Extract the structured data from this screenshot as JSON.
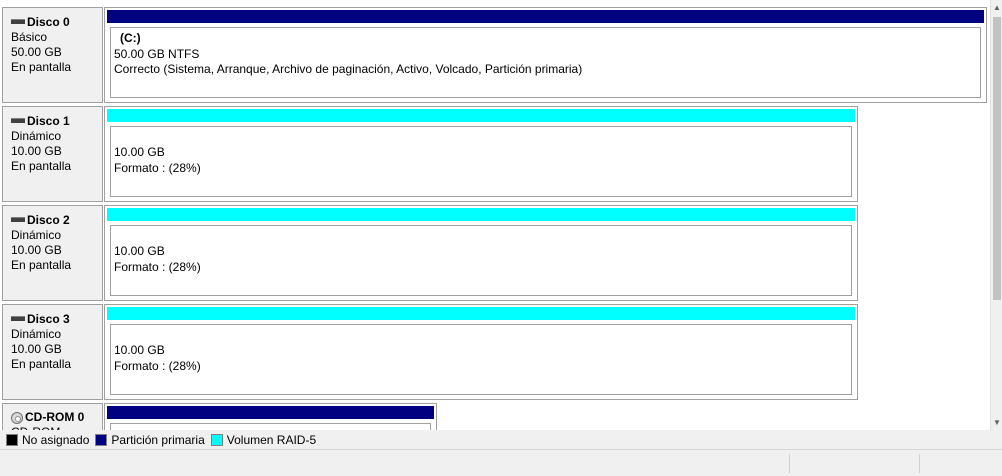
{
  "disks": [
    {
      "name": "Disco 0",
      "type": "Básico",
      "size": "50.00 GB",
      "status": "En pantalla",
      "volume": {
        "title": "(C:)",
        "line1": "50.00 GB NTFS",
        "line2": "Correcto (Sistema, Arranque, Archivo de paginación, Activo, Volcado, Partición primaria)",
        "bar_color": "#000080"
      }
    },
    {
      "name": "Disco 1",
      "type": "Dinámico",
      "size": "10.00 GB",
      "status": "En pantalla",
      "volume": {
        "title": "",
        "line1": "10.00 GB",
        "line2": "Formato : (28%)",
        "bar_color": "#00ffff"
      }
    },
    {
      "name": "Disco 2",
      "type": "Dinámico",
      "size": "10.00 GB",
      "status": "En pantalla",
      "volume": {
        "title": "",
        "line1": "10.00 GB",
        "line2": "Formato : (28%)",
        "bar_color": "#00ffff"
      }
    },
    {
      "name": "Disco 3",
      "type": "Dinámico",
      "size": "10.00 GB",
      "status": "En pantalla",
      "volume": {
        "title": "",
        "line1": "10.00 GB",
        "line2": "Formato : (28%)",
        "bar_color": "#00ffff"
      }
    },
    {
      "name": "CD-ROM 0",
      "type": "CD-ROM",
      "size": "",
      "status": "",
      "volume": {
        "title": "",
        "line1": "",
        "line2": "",
        "bar_color": "#000080"
      }
    }
  ],
  "legend": [
    {
      "label": "No asignado",
      "color": "#000000"
    },
    {
      "label": "Partición primaria",
      "color": "#000080"
    },
    {
      "label": "Volumen RAID-5",
      "color": "#00ffff"
    }
  ]
}
